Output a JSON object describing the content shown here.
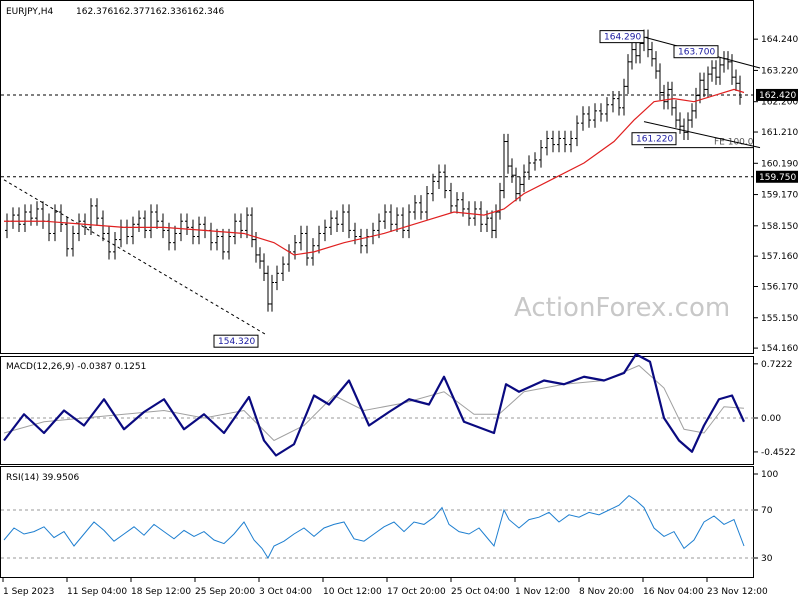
{
  "chart_data": {
    "type": "candlestick",
    "symbol": "EURJPY,H4",
    "ohlc": {
      "open": "162.376",
      "high": "162.377",
      "low": "162.336",
      "close": "162.346"
    },
    "watermark": "ActionForex.com",
    "price_axis": {
      "ylim": [
        154.0,
        164.8
      ],
      "ticks": [
        "164.240",
        "163.220",
        "162.200",
        "161.210",
        "160.190",
        "159.170",
        "158.150",
        "157.160",
        "156.170",
        "155.150",
        "154.160"
      ]
    },
    "x_axis": {
      "labels": [
        "1 Sep 2023",
        "11 Sep 04:00",
        "18 Sep 12:00",
        "25 Sep 20:00",
        "3 Oct 04:00",
        "10 Oct 12:00",
        "17 Oct 20:00",
        "25 Oct 04:00",
        "1 Nov 12:00",
        "8 Nov 20:00",
        "16 Nov 04:00",
        "23 Nov 12:00"
      ]
    },
    "price_series": [
      [
        0,
        158.0
      ],
      [
        6,
        158.3
      ],
      [
        12,
        158.5
      ],
      [
        18,
        158.2
      ],
      [
        24,
        158.6
      ],
      [
        30,
        158.4
      ],
      [
        36,
        158.7
      ],
      [
        42,
        158.3
      ],
      [
        48,
        157.9
      ],
      [
        54,
        158.6
      ],
      [
        60,
        158.2
      ],
      [
        66,
        157.4
      ],
      [
        72,
        157.9
      ],
      [
        78,
        158.3
      ],
      [
        84,
        158.1
      ],
      [
        90,
        158.8
      ],
      [
        96,
        158.4
      ],
      [
        102,
        157.9
      ],
      [
        108,
        157.3
      ],
      [
        114,
        157.7
      ],
      [
        120,
        158.1
      ],
      [
        126,
        157.8
      ],
      [
        132,
        158.2
      ],
      [
        138,
        158.4
      ],
      [
        144,
        158.0
      ],
      [
        150,
        158.6
      ],
      [
        156,
        158.3
      ],
      [
        162,
        158.0
      ],
      [
        168,
        157.6
      ],
      [
        174,
        157.9
      ],
      [
        180,
        158.3
      ],
      [
        186,
        158.1
      ],
      [
        192,
        157.8
      ],
      [
        198,
        158.2
      ],
      [
        204,
        158.0
      ],
      [
        210,
        157.6
      ],
      [
        216,
        157.8
      ],
      [
        222,
        157.3
      ],
      [
        228,
        157.8
      ],
      [
        234,
        158.3
      ],
      [
        240,
        158.0
      ],
      [
        246,
        158.5
      ],
      [
        250,
        157.7
      ],
      [
        254,
        157.2
      ],
      [
        258,
        157.0
      ],
      [
        262,
        156.6
      ],
      [
        266,
        155.6
      ],
      [
        270,
        156.3
      ],
      [
        276,
        156.6
      ],
      [
        282,
        156.9
      ],
      [
        288,
        157.3
      ],
      [
        294,
        157.6
      ],
      [
        300,
        157.9
      ],
      [
        306,
        157.1
      ],
      [
        312,
        157.5
      ],
      [
        318,
        157.9
      ],
      [
        324,
        158.1
      ],
      [
        330,
        158.4
      ],
      [
        336,
        158.2
      ],
      [
        342,
        158.6
      ],
      [
        348,
        158.0
      ],
      [
        354,
        157.8
      ],
      [
        360,
        157.5
      ],
      [
        366,
        157.8
      ],
      [
        372,
        158.0
      ],
      [
        378,
        158.3
      ],
      [
        384,
        158.6
      ],
      [
        390,
        158.2
      ],
      [
        396,
        158.5
      ],
      [
        402,
        158.0
      ],
      [
        408,
        158.6
      ],
      [
        414,
        158.9
      ],
      [
        420,
        158.6
      ],
      [
        426,
        159.2
      ],
      [
        432,
        159.6
      ],
      [
        438,
        159.9
      ],
      [
        444,
        159.3
      ],
      [
        450,
        158.8
      ],
      [
        456,
        159.0
      ],
      [
        462,
        158.7
      ],
      [
        468,
        158.4
      ],
      [
        474,
        158.7
      ],
      [
        480,
        158.2
      ],
      [
        486,
        158.4
      ],
      [
        490,
        158.0
      ],
      [
        494,
        158.6
      ],
      [
        498,
        159.3
      ],
      [
        502,
        160.9
      ],
      [
        506,
        160.1
      ],
      [
        510,
        159.8
      ],
      [
        514,
        159.2
      ],
      [
        518,
        159.5
      ],
      [
        522,
        159.9
      ],
      [
        528,
        160.2
      ],
      [
        534,
        160.3
      ],
      [
        540,
        160.7
      ],
      [
        546,
        161.0
      ],
      [
        552,
        160.8
      ],
      [
        558,
        161.0
      ],
      [
        564,
        160.8
      ],
      [
        570,
        161.0
      ],
      [
        576,
        161.5
      ],
      [
        582,
        161.8
      ],
      [
        588,
        161.6
      ],
      [
        594,
        161.9
      ],
      [
        600,
        161.8
      ],
      [
        606,
        162.1
      ],
      [
        612,
        162.3
      ],
      [
        618,
        162.0
      ],
      [
        622,
        162.7
      ],
      [
        626,
        163.5
      ],
      [
        630,
        163.9
      ],
      [
        634,
        163.7
      ],
      [
        638,
        164.1
      ],
      [
        642,
        164.3
      ],
      [
        646,
        163.9
      ],
      [
        650,
        163.6
      ],
      [
        654,
        163.2
      ],
      [
        658,
        162.5
      ],
      [
        662,
        162.2
      ],
      [
        666,
        162.6
      ],
      [
        670,
        162.0
      ],
      [
        674,
        161.6
      ],
      [
        678,
        161.4
      ],
      [
        682,
        161.2
      ],
      [
        686,
        161.6
      ],
      [
        690,
        161.9
      ],
      [
        694,
        162.4
      ],
      [
        698,
        162.9
      ],
      [
        702,
        162.6
      ],
      [
        706,
        163.1
      ],
      [
        710,
        163.3
      ],
      [
        714,
        163.0
      ],
      [
        718,
        163.4
      ],
      [
        722,
        163.6
      ],
      [
        726,
        163.5
      ],
      [
        730,
        163.0
      ],
      [
        734,
        162.8
      ],
      [
        738,
        162.35
      ]
    ],
    "moving_average": [
      [
        0,
        158.3
      ],
      [
        40,
        158.3
      ],
      [
        80,
        158.2
      ],
      [
        120,
        158.1
      ],
      [
        160,
        158.1
      ],
      [
        200,
        158.0
      ],
      [
        240,
        157.9
      ],
      [
        270,
        157.6
      ],
      [
        290,
        157.2
      ],
      [
        310,
        157.3
      ],
      [
        340,
        157.6
      ],
      [
        380,
        157.9
      ],
      [
        420,
        158.3
      ],
      [
        450,
        158.6
      ],
      [
        480,
        158.5
      ],
      [
        500,
        158.7
      ],
      [
        520,
        159.2
      ],
      [
        550,
        159.7
      ],
      [
        580,
        160.2
      ],
      [
        610,
        160.9
      ],
      [
        630,
        161.6
      ],
      [
        650,
        162.2
      ],
      [
        670,
        162.3
      ],
      [
        690,
        162.2
      ],
      [
        710,
        162.4
      ],
      [
        730,
        162.6
      ],
      [
        740,
        162.5
      ]
    ],
    "levels": [
      {
        "price": 162.42,
        "label": "162.420",
        "style": "dashed"
      },
      {
        "price": 159.75,
        "label": "159.750",
        "style": "dashed"
      },
      {
        "price": 160.7,
        "label": "FE 100.0",
        "style": "solid"
      }
    ],
    "annotations": [
      {
        "label": "164.290",
        "x": 642,
        "price": 164.29
      },
      {
        "label": "163.700",
        "x": 718,
        "price": 163.7
      },
      {
        "label": "161.220",
        "x": 682,
        "price": 161.22
      },
      {
        "label": "154.320",
        "x": 266,
        "price": 154.32
      }
    ],
    "trendlines": [
      {
        "from": [
          0,
          159.65
        ],
        "to": [
          262,
          154.6
        ],
        "style": "dashed"
      },
      {
        "from": [
          642,
          164.29
        ],
        "to": [
          756,
          163.3
        ],
        "style": "solid"
      },
      {
        "from": [
          640,
          161.55
        ],
        "to": [
          756,
          160.7
        ],
        "style": "solid"
      }
    ],
    "macd": {
      "label": "MACD(12,26,9) -0.0387 0.1251",
      "ylim": [
        -0.6,
        0.8
      ],
      "ticks": [
        "0.7222",
        "0.00",
        "-0.4522"
      ],
      "series": [
        [
          0,
          -0.3
        ],
        [
          20,
          0.05
        ],
        [
          40,
          -0.2
        ],
        [
          60,
          0.1
        ],
        [
          80,
          -0.1
        ],
        [
          100,
          0.25
        ],
        [
          120,
          -0.15
        ],
        [
          140,
          0.08
        ],
        [
          160,
          0.25
        ],
        [
          180,
          -0.15
        ],
        [
          200,
          0.05
        ],
        [
          220,
          -0.2
        ],
        [
          245,
          0.28
        ],
        [
          260,
          -0.3
        ],
        [
          272,
          -0.5
        ],
        [
          290,
          -0.35
        ],
        [
          310,
          0.3
        ],
        [
          325,
          0.18
        ],
        [
          345,
          0.5
        ],
        [
          365,
          -0.1
        ],
        [
          385,
          0.08
        ],
        [
          405,
          0.25
        ],
        [
          425,
          0.18
        ],
        [
          440,
          0.55
        ],
        [
          460,
          -0.05
        ],
        [
          480,
          -0.15
        ],
        [
          490,
          -0.2
        ],
        [
          502,
          0.45
        ],
        [
          515,
          0.35
        ],
        [
          540,
          0.5
        ],
        [
          560,
          0.45
        ],
        [
          580,
          0.55
        ],
        [
          600,
          0.5
        ],
        [
          620,
          0.6
        ],
        [
          632,
          0.85
        ],
        [
          646,
          0.75
        ],
        [
          660,
          0.0
        ],
        [
          675,
          -0.3
        ],
        [
          688,
          -0.45
        ],
        [
          700,
          -0.1
        ],
        [
          715,
          0.25
        ],
        [
          728,
          0.3
        ],
        [
          740,
          -0.05
        ]
      ],
      "signal": [
        [
          0,
          -0.2
        ],
        [
          40,
          -0.05
        ],
        [
          80,
          0.0
        ],
        [
          120,
          0.05
        ],
        [
          160,
          0.1
        ],
        [
          200,
          0.0
        ],
        [
          240,
          0.1
        ],
        [
          270,
          -0.3
        ],
        [
          300,
          -0.1
        ],
        [
          330,
          0.3
        ],
        [
          360,
          0.1
        ],
        [
          400,
          0.2
        ],
        [
          440,
          0.35
        ],
        [
          470,
          0.05
        ],
        [
          495,
          0.05
        ],
        [
          520,
          0.35
        ],
        [
          560,
          0.45
        ],
        [
          600,
          0.5
        ],
        [
          635,
          0.7
        ],
        [
          660,
          0.4
        ],
        [
          680,
          -0.15
        ],
        [
          700,
          -0.2
        ],
        [
          720,
          0.15
        ],
        [
          740,
          0.13
        ]
      ]
    },
    "rsi": {
      "label": "RSI(14) 39.9506",
      "ylim": [
        15,
        105
      ],
      "ticks": [
        "100",
        "70",
        "30"
      ],
      "levels": [
        70,
        30
      ],
      "series": [
        [
          0,
          45
        ],
        [
          10,
          55
        ],
        [
          20,
          50
        ],
        [
          30,
          52
        ],
        [
          40,
          56
        ],
        [
          50,
          47
        ],
        [
          60,
          52
        ],
        [
          70,
          40
        ],
        [
          80,
          50
        ],
        [
          90,
          60
        ],
        [
          100,
          53
        ],
        [
          110,
          44
        ],
        [
          120,
          50
        ],
        [
          130,
          56
        ],
        [
          140,
          49
        ],
        [
          150,
          58
        ],
        [
          160,
          52
        ],
        [
          170,
          46
        ],
        [
          180,
          53
        ],
        [
          190,
          48
        ],
        [
          200,
          52
        ],
        [
          210,
          45
        ],
        [
          220,
          42
        ],
        [
          230,
          50
        ],
        [
          240,
          60
        ],
        [
          250,
          45
        ],
        [
          258,
          38
        ],
        [
          264,
          30
        ],
        [
          270,
          40
        ],
        [
          280,
          44
        ],
        [
          290,
          50
        ],
        [
          300,
          55
        ],
        [
          310,
          48
        ],
        [
          320,
          55
        ],
        [
          330,
          58
        ],
        [
          340,
          60
        ],
        [
          350,
          46
        ],
        [
          360,
          44
        ],
        [
          370,
          50
        ],
        [
          380,
          56
        ],
        [
          390,
          60
        ],
        [
          400,
          52
        ],
        [
          410,
          60
        ],
        [
          420,
          58
        ],
        [
          430,
          64
        ],
        [
          438,
          72
        ],
        [
          445,
          58
        ],
        [
          455,
          52
        ],
        [
          465,
          50
        ],
        [
          475,
          55
        ],
        [
          485,
          45
        ],
        [
          490,
          40
        ],
        [
          500,
          70
        ],
        [
          505,
          62
        ],
        [
          515,
          55
        ],
        [
          525,
          62
        ],
        [
          535,
          64
        ],
        [
          545,
          68
        ],
        [
          555,
          60
        ],
        [
          565,
          66
        ],
        [
          575,
          64
        ],
        [
          585,
          68
        ],
        [
          595,
          66
        ],
        [
          605,
          70
        ],
        [
          615,
          74
        ],
        [
          625,
          82
        ],
        [
          632,
          78
        ],
        [
          640,
          72
        ],
        [
          650,
          55
        ],
        [
          660,
          48
        ],
        [
          670,
          52
        ],
        [
          680,
          38
        ],
        [
          690,
          45
        ],
        [
          700,
          60
        ],
        [
          710,
          65
        ],
        [
          720,
          58
        ],
        [
          730,
          62
        ],
        [
          740,
          40
        ]
      ]
    }
  }
}
